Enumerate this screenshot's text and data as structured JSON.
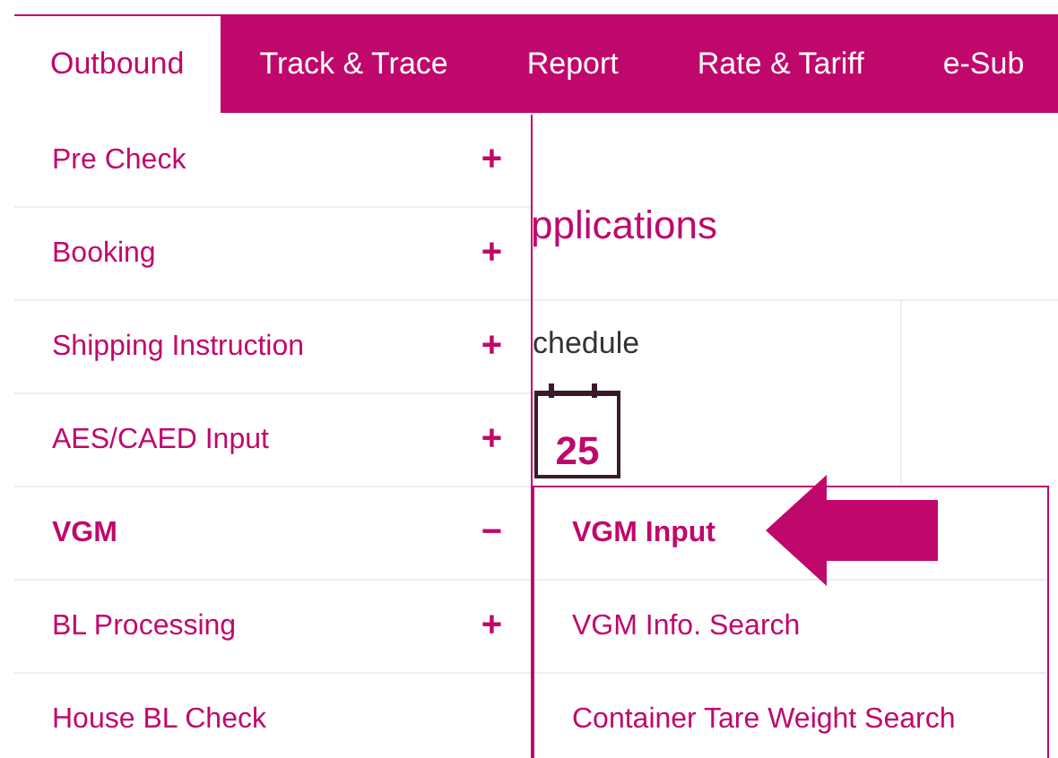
{
  "nav": {
    "tabs": [
      {
        "label": "Outbound",
        "selected": true
      },
      {
        "label": "Track & Trace",
        "selected": false
      },
      {
        "label": "Report",
        "selected": false
      },
      {
        "label": "Rate & Tariff",
        "selected": false
      },
      {
        "label": "e-Sub",
        "selected": false
      }
    ]
  },
  "page": {
    "heading": "pplications",
    "card_title": "chedule",
    "calendar_day": "25"
  },
  "menu": {
    "items": [
      {
        "label": "Pre Check",
        "toggle": "+",
        "expanded": false
      },
      {
        "label": "Booking",
        "toggle": "+",
        "expanded": false
      },
      {
        "label": "Shipping Instruction",
        "toggle": "+",
        "expanded": false
      },
      {
        "label": "AES/CAED Input",
        "toggle": "+",
        "expanded": false
      },
      {
        "label": "VGM",
        "toggle": "−",
        "expanded": true
      },
      {
        "label": "BL Processing",
        "toggle": "+",
        "expanded": false
      },
      {
        "label": "House BL Check",
        "expanded": false
      }
    ]
  },
  "submenu": {
    "items": [
      {
        "label": "VGM Input",
        "selected": true
      },
      {
        "label": "VGM Info. Search",
        "selected": false
      },
      {
        "label": "Container Tare Weight Search",
        "selected": false
      }
    ]
  }
}
